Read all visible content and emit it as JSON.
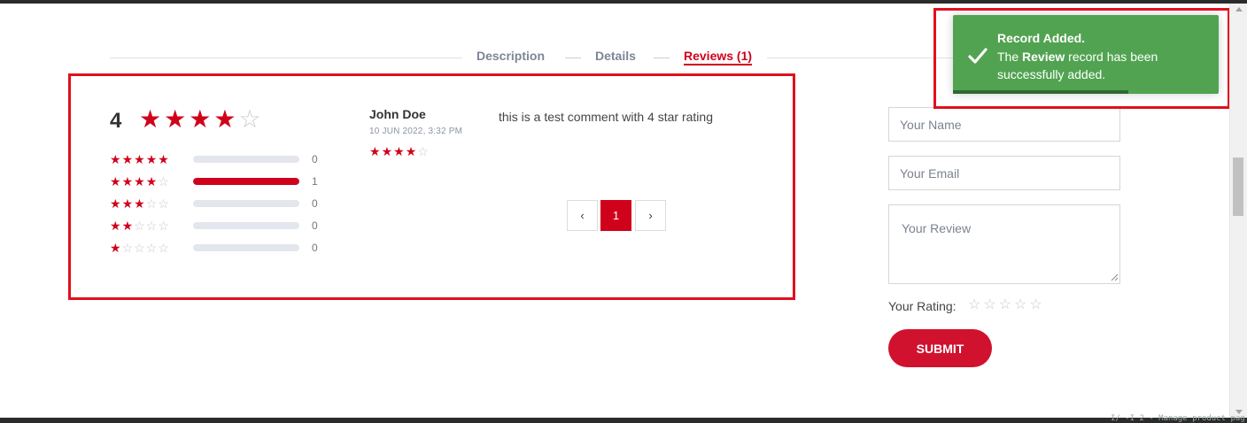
{
  "tabs": [
    {
      "label": "Description",
      "active": false
    },
    {
      "label": "Details",
      "active": false
    },
    {
      "label": "Reviews (1)",
      "active": true
    }
  ],
  "summary": {
    "average": "4",
    "average_stars": 4,
    "distribution": [
      {
        "stars": 5,
        "count": "0",
        "fraction": 0
      },
      {
        "stars": 4,
        "count": "1",
        "fraction": 1
      },
      {
        "stars": 3,
        "count": "0",
        "fraction": 0
      },
      {
        "stars": 2,
        "count": "0",
        "fraction": 0
      },
      {
        "stars": 1,
        "count": "0",
        "fraction": 0
      }
    ]
  },
  "review": {
    "author": "John Doe",
    "date": "10 JUN 2022, 3:32 PM",
    "rating": 4,
    "comment": "this is a test comment with 4 star rating"
  },
  "pagination": {
    "prev": "‹",
    "page": "1",
    "next": "›"
  },
  "form": {
    "name_placeholder": "Your Name",
    "email_placeholder": "Your Email",
    "review_placeholder": "Your Review",
    "rating_label": "Your Rating:",
    "rating_value": 0,
    "submit_label": "SUBMIT"
  },
  "toast": {
    "title": "Record Added.",
    "message_prefix": "The ",
    "message_bold": "Review",
    "message_suffix": " record has been successfully added.",
    "progress": 0.66
  },
  "colors": {
    "accent": "#d0021b",
    "toast_bg": "#51a351",
    "highlight": "#e0101c"
  },
  "bottom_strip_text": "I/ -I 2 - Manage product pag"
}
